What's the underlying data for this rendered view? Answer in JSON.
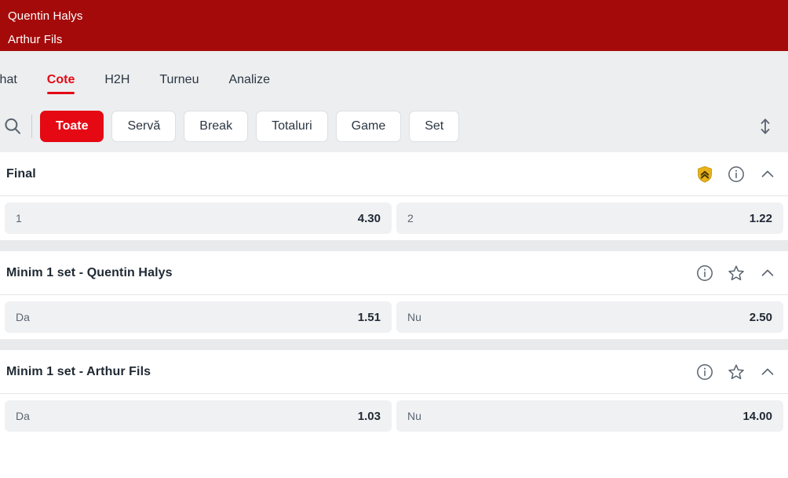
{
  "match_header": {
    "player_top": "Quentin Halys",
    "player_bottom": "Arthur Fils",
    "bg_color": "#a50a0a"
  },
  "tabs": [
    {
      "label": "Chat",
      "active": false
    },
    {
      "label": "Cote",
      "active": true
    },
    {
      "label": "H2H",
      "active": false
    },
    {
      "label": "Turneu",
      "active": false
    },
    {
      "label": "Analize",
      "active": false
    }
  ],
  "filters": {
    "search_icon": "search-icon",
    "sort_icon": "sort-vertical-icon",
    "chips": [
      {
        "label": "Toate",
        "active": true
      },
      {
        "label": "Servă",
        "active": false
      },
      {
        "label": "Break",
        "active": false
      },
      {
        "label": "Totaluri",
        "active": false
      },
      {
        "label": "Game",
        "active": false
      },
      {
        "label": "Set",
        "active": false
      }
    ],
    "active_color": "#e50914"
  },
  "markets": [
    {
      "title": "Final",
      "icons": [
        "boost-shield-icon",
        "info-icon",
        "chevron-up-icon"
      ],
      "odds": [
        {
          "label": "1",
          "value": "4.30"
        },
        {
          "label": "2",
          "value": "1.22"
        }
      ]
    },
    {
      "title": "Minim 1 set - Quentin Halys",
      "icons": [
        "info-icon",
        "star-icon",
        "chevron-up-icon"
      ],
      "odds": [
        {
          "label": "Da",
          "value": "1.51"
        },
        {
          "label": "Nu",
          "value": "2.50"
        }
      ]
    },
    {
      "title": "Minim 1 set - Arthur Fils",
      "icons": [
        "info-icon",
        "star-icon",
        "chevron-up-icon"
      ],
      "odds": [
        {
          "label": "Da",
          "value": "1.03"
        },
        {
          "label": "Nu",
          "value": "14.00"
        }
      ]
    }
  ],
  "colors": {
    "header_red": "#a50a0a",
    "accent_red": "#e50914",
    "shield_gold": "#e8b419",
    "odd_bg": "#f0f1f3",
    "tabbar_bg": "#eceef0"
  }
}
